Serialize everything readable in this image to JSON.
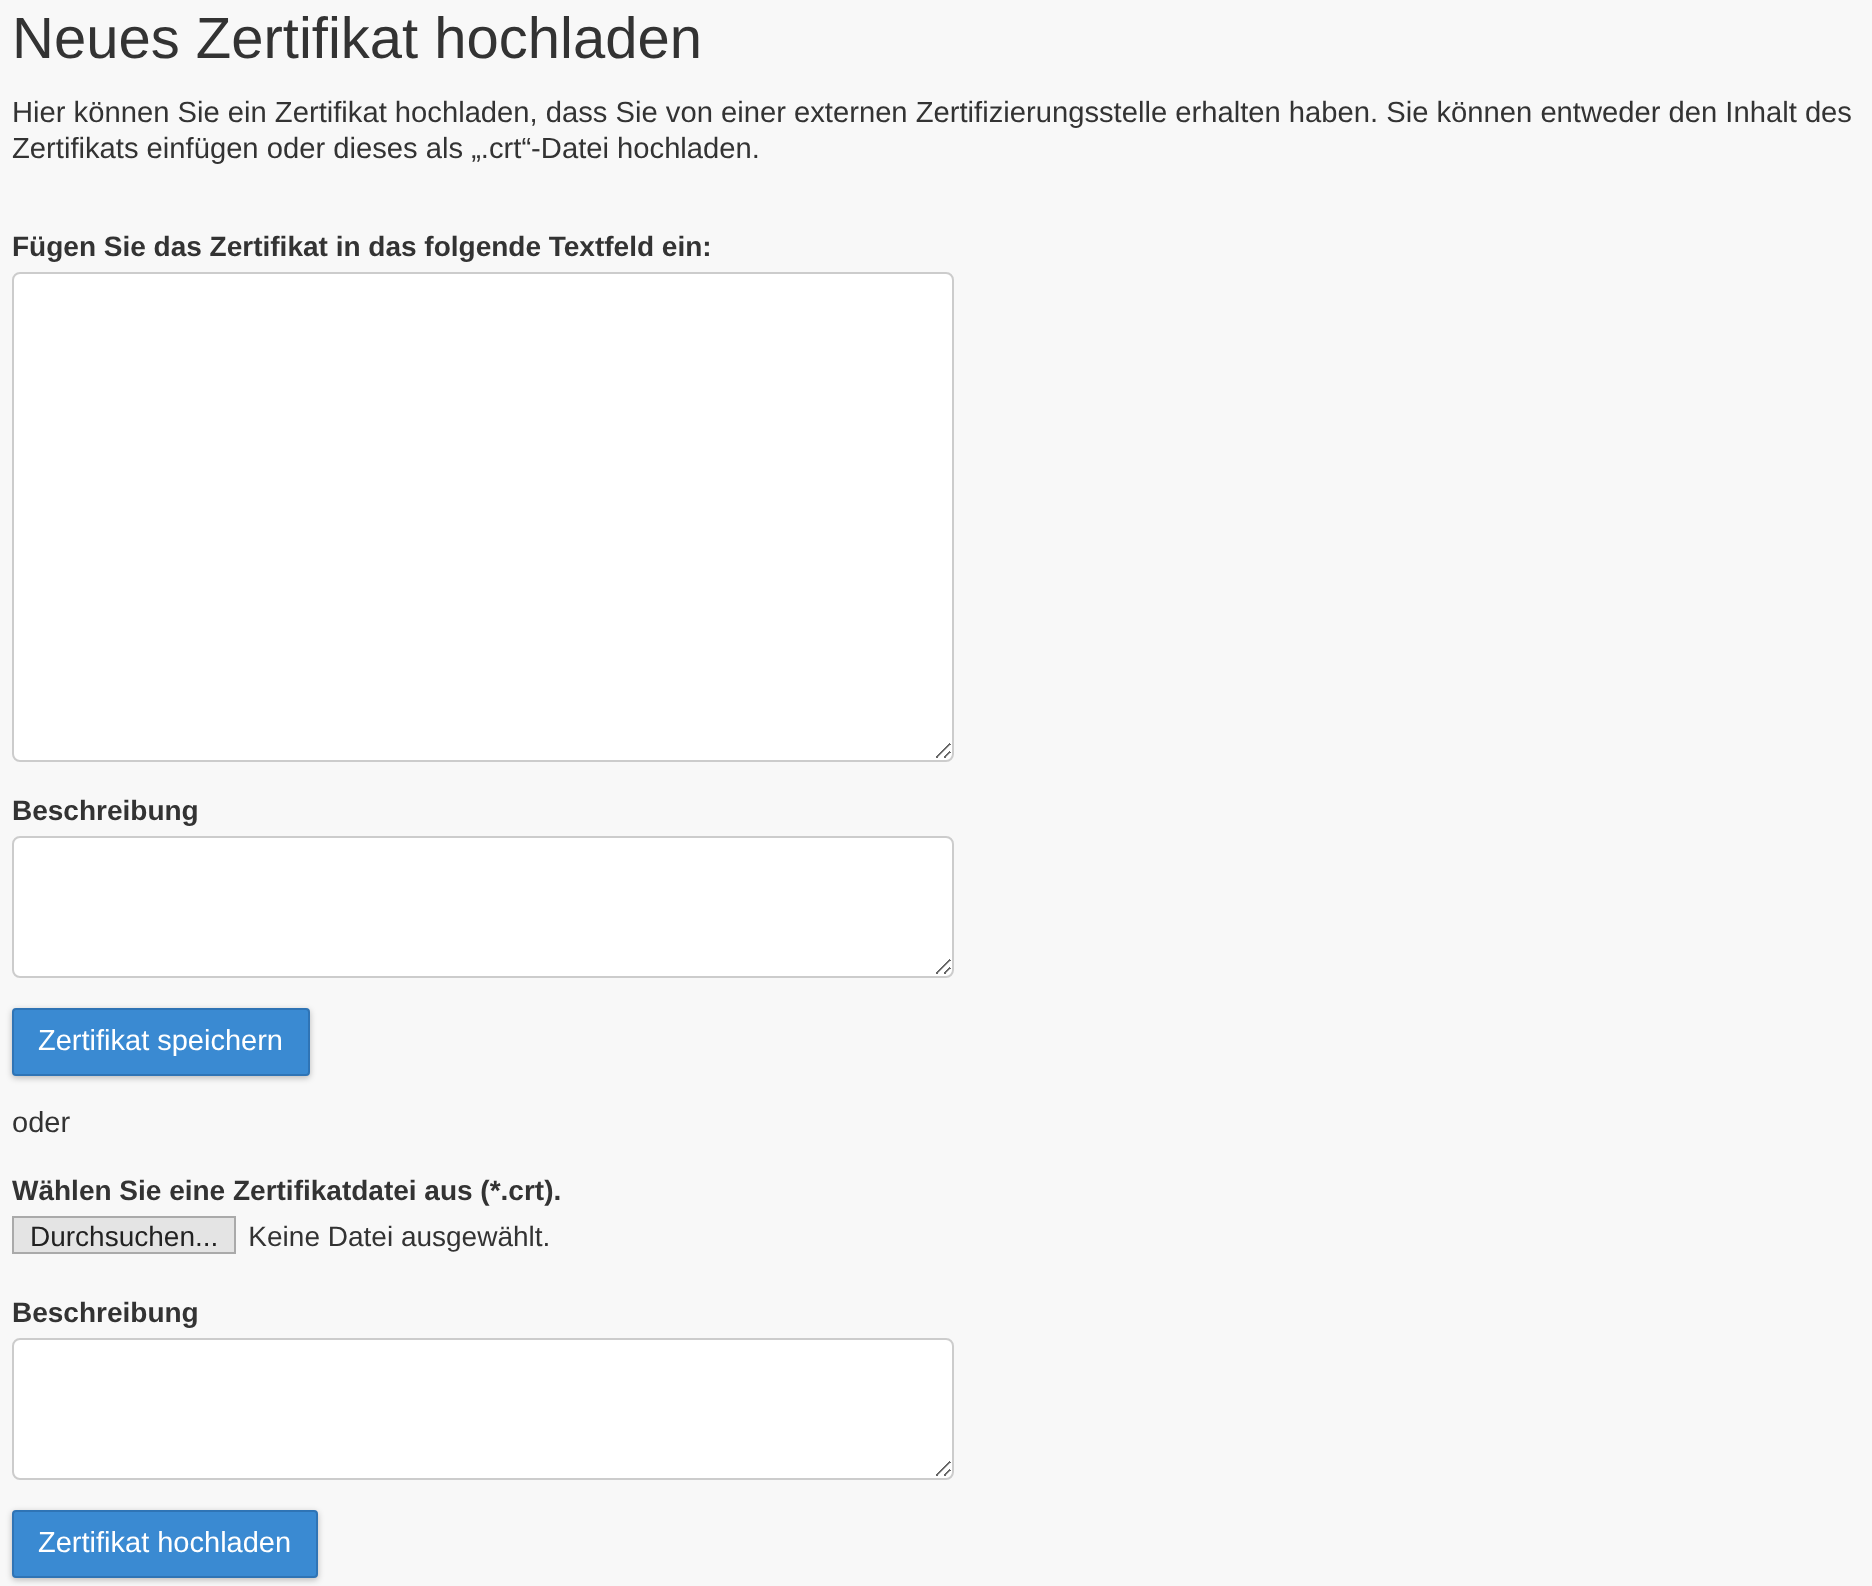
{
  "title": "Neues Zertifikat hochladen",
  "intro": "Hier können Sie ein Zertifikat hochladen, dass Sie von einer externen Zertifizierungsstelle erhalten haben. Sie können entweder den Inhalt des Zertifikats einfügen oder dieses als „.crt“-Datei hochladen.",
  "items": [
    {
      "kind": "label",
      "text": "Fügen Sie das Zertifikat in das folgende Textfeld ein:"
    },
    {
      "kind": "textarea-large"
    },
    {
      "kind": "label",
      "text": "Beschreibung"
    },
    {
      "kind": "textarea"
    },
    {
      "kind": "button",
      "text": "Zertifikat speichern"
    },
    {
      "kind": "text",
      "text": "oder"
    },
    {
      "kind": "label",
      "text": "Wählen Sie eine Zertifikatdatei aus (*.crt)."
    },
    {
      "kind": "file",
      "button": "Durchsuchen...",
      "status": "Keine Datei ausgewählt."
    },
    {
      "kind": "label",
      "text": "Beschreibung"
    },
    {
      "kind": "textarea"
    },
    {
      "kind": "button",
      "text": "Zertifikat hochladen"
    }
  ]
}
